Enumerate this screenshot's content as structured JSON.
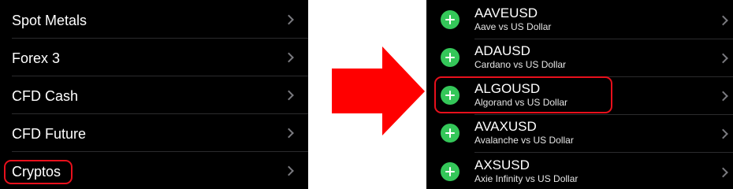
{
  "categories": {
    "items": [
      {
        "label": "Spot Metals"
      },
      {
        "label": "Forex 3"
      },
      {
        "label": "CFD Cash"
      },
      {
        "label": "CFD Future"
      },
      {
        "label": "Cryptos",
        "highlighted": true
      }
    ]
  },
  "symbols": {
    "items": [
      {
        "symbol": "AAVEUSD",
        "description": "Aave vs US Dollar"
      },
      {
        "symbol": "ADAUSD",
        "description": "Cardano vs US Dollar"
      },
      {
        "symbol": "ALGOUSD",
        "description": "Algorand vs US Dollar",
        "highlighted": true
      },
      {
        "symbol": "AVAXUSD",
        "description": "Avalanche vs US Dollar"
      },
      {
        "symbol": "AXSUSD",
        "description": "Axie Infinity vs US Dollar"
      }
    ]
  },
  "icons": {
    "add": "plus-circle-icon",
    "chevron": "chevron-right-icon",
    "arrow": "right-arrow-icon"
  },
  "colors": {
    "panel_background": "#000000",
    "text": "#ffffff",
    "add_button": "#34c759",
    "highlight": "#e8101c",
    "arrow": "#ff0000",
    "chevron": "#7a7a7f"
  }
}
